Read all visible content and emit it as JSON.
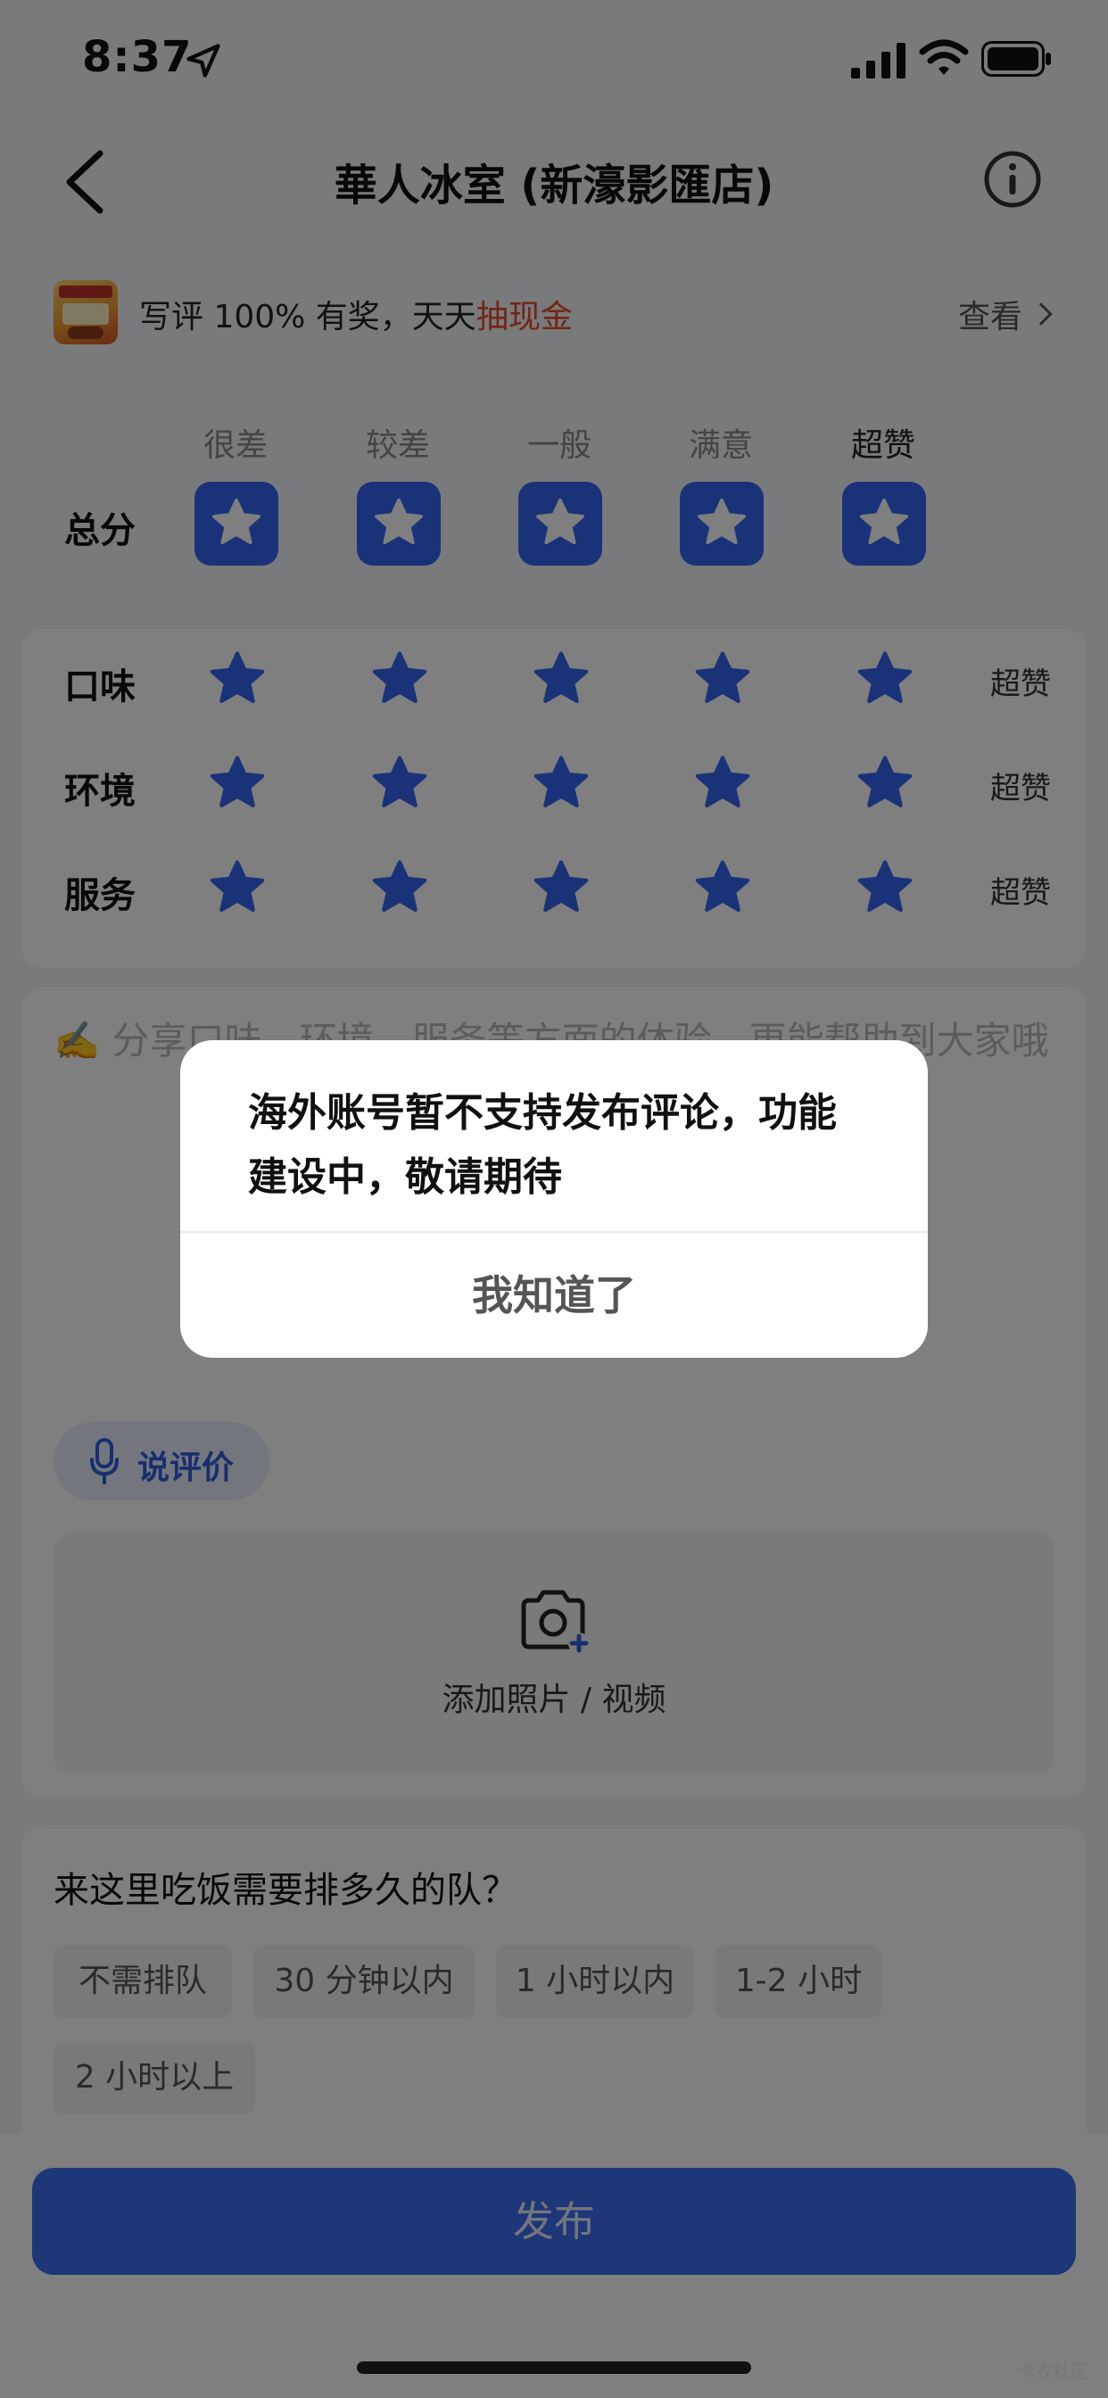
{
  "status_bar": {
    "time": "8:37"
  },
  "nav": {
    "title": "華人冰室 (新濠影匯店)"
  },
  "promo": {
    "text_prefix": "写评 100% 有奖，天天",
    "text_highlight": "抽现金",
    "link_label": "查看"
  },
  "rating": {
    "levels": [
      "很差",
      "较差",
      "一般",
      "满意",
      "超赞"
    ],
    "total_label": "总分",
    "total_stars": 5,
    "sub_ratings": [
      {
        "label": "口味",
        "stars": 5,
        "value": "超赞"
      },
      {
        "label": "环境",
        "stars": 5,
        "value": "超赞"
      },
      {
        "label": "服务",
        "stars": 5,
        "value": "超赞"
      }
    ]
  },
  "review": {
    "placeholder": "✍️ 分享口味、环境、服务等方面的体验，更能帮助到大家哦",
    "voice_label": "说评价",
    "upload_label": "添加照片 / 视频"
  },
  "queue": {
    "title": "来这里吃饭需要排多久的队？",
    "options": [
      "不需排队",
      "30 分钟以内",
      "1 小时以内",
      "1-2 小时",
      "2 小时以上"
    ]
  },
  "publish_label": "发布",
  "dialog": {
    "message": "海外账号暂不支持发布评论，功能建设中，敬请期待",
    "button_label": "我知道了"
  },
  "watermark": "卡农社区",
  "colors": {
    "accent": "#3566f0",
    "highlight": "#e8482b"
  }
}
